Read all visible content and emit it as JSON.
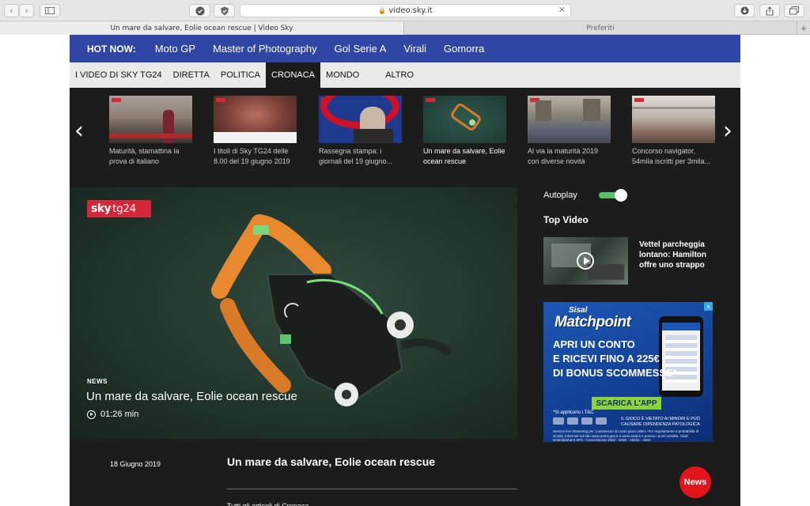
{
  "browser": {
    "url": "video.sky.it",
    "tabs": [
      {
        "title": "Un mare da salvare, Eolie ocean rescue | Video Sky",
        "active": true
      },
      {
        "title": "Preferiti",
        "active": false
      }
    ],
    "newtab": "+"
  },
  "hotnow": {
    "label": "HOT NOW:",
    "items": [
      "Moto GP",
      "Master of Photography",
      "Gol Serie A",
      "Virali",
      "Gomorra"
    ]
  },
  "categories": {
    "items": [
      "I VIDEO DI SKY TG24",
      "DIRETTA",
      "POLITICA",
      "CRONACA",
      "MONDO",
      "ALTRO"
    ],
    "active": "CRONACA"
  },
  "carousel": {
    "items": [
      {
        "caption": "Maturità, stamattina la prova di italiano",
        "current": false
      },
      {
        "caption": "I titoli di Sky TG24 delle 8.00 del 19 giugno 2019",
        "current": false
      },
      {
        "caption": "Rassegna stampa: i giornali del 19 giugno...",
        "current": false
      },
      {
        "caption": "Un mare da salvare, Eolie ocean rescue",
        "current": true
      },
      {
        "caption": "Al via la maturità 2019 con diverse novità",
        "current": false
      },
      {
        "caption": "Concorso navigator, 54mila iscritti per 3mila...",
        "current": false
      }
    ]
  },
  "player": {
    "logo_sky": "sky",
    "logo_tg": "tg24",
    "category": "NEWS",
    "title": "Un mare da salvare, Eolie ocean rescue",
    "duration": "01:26 min"
  },
  "sidebar": {
    "autoplay_label": "Autoplay",
    "autoplay_on": true,
    "top_video_title": "Top Video",
    "top_video_text": "Vettel parcheggia lontano: Hamilton offre uno strappo"
  },
  "ad": {
    "close": "×",
    "brand_small": "Sisal",
    "brand": "Matchpoint",
    "line1": "APRI UN CONTO",
    "line2": "E RICEVI FINO A 225€",
    "line3": "DI BONUS SCOMMESSE*",
    "cta": "SCARICA L'APP",
    "tc": "*Si applicano i T&C",
    "warning": "IL GIOCO È VIETATO AI MINORI E PUÒ CAUSARE DIPENDENZA PATOLOGICA",
    "fine": "Service live streaming per i possessori di conto gioco attivo. Per regolamento e probabilità di vincita, informati sul sito www.aams.gov.it e www.sisal.it e presso i punti vendita. Sisal Entertainment SPA - Concessione 4502 - 4030 - 15015 - 4402"
  },
  "article": {
    "date": "18 Giugno 2019",
    "title": "Un mare da salvare, Eolie ocean rescue",
    "more": "Tutti gli articoli di Cronaca"
  },
  "news_badge": "News"
}
